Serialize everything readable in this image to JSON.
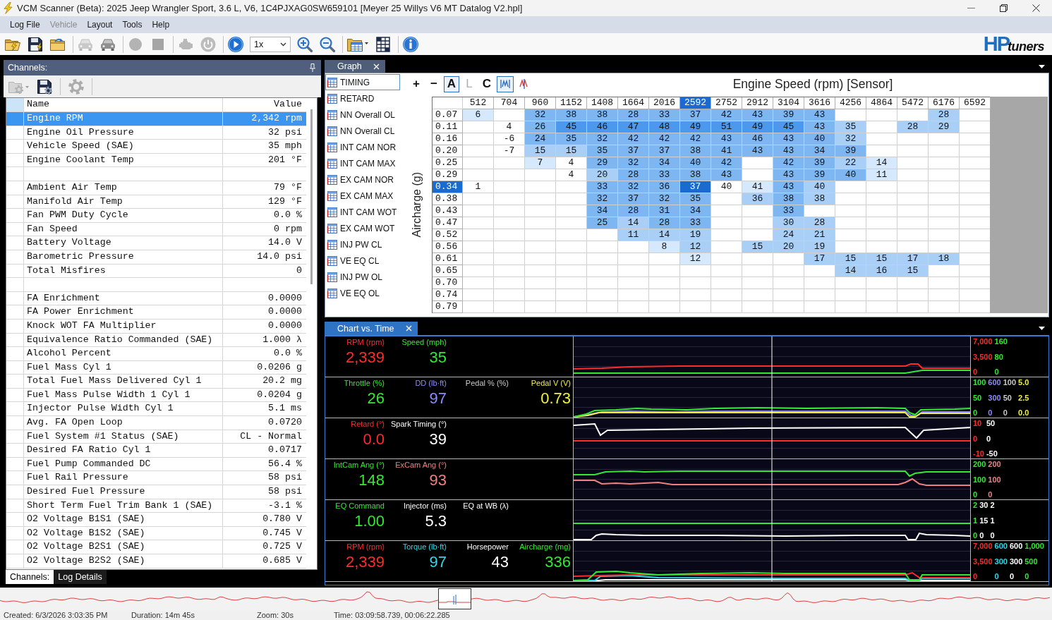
{
  "window": {
    "title": "VCM Scanner (Beta): 2025 Jeep Wrangler Sport, 3.6 L, V6, 1C4PJXAG0SW659101 [Meyer 25 Willys V6 MT Datalog V2.hpl]"
  },
  "menu": [
    {
      "label": "Log File",
      "disabled": false
    },
    {
      "label": "Vehicle",
      "disabled": true
    },
    {
      "label": "Layout",
      "disabled": false
    },
    {
      "label": "Tools",
      "disabled": false
    },
    {
      "label": "Help",
      "disabled": false
    }
  ],
  "toolbar": {
    "groups": [
      [
        {
          "kind": "open",
          "disabled": false
        },
        {
          "kind": "save",
          "disabled": false
        },
        {
          "kind": "reload",
          "disabled": false
        }
      ],
      [
        {
          "kind": "car",
          "disabled": true
        },
        {
          "kind": "car",
          "disabled": false
        }
      ],
      [
        {
          "kind": "record",
          "disabled": true
        },
        {
          "kind": "stop",
          "disabled": true
        }
      ],
      [
        {
          "kind": "engine",
          "disabled": true
        },
        {
          "kind": "power",
          "disabled": true
        }
      ],
      [
        {
          "kind": "play",
          "disabled": false
        },
        {
          "kind": "combo",
          "value": "1x",
          "disabled": false
        },
        {
          "kind": "zoom-in",
          "disabled": false
        },
        {
          "kind": "zoom-out",
          "disabled": false
        }
      ],
      [
        {
          "kind": "layout",
          "disabled": false
        },
        {
          "kind": "grid-save",
          "disabled": false
        }
      ],
      [
        {
          "kind": "info",
          "disabled": false
        }
      ]
    ],
    "logo": {
      "mark": "HP",
      "word": "tuners"
    }
  },
  "channels_panel": {
    "title": "Channels:",
    "tools": [
      {
        "kind": "folder-settings",
        "disabled": true
      },
      {
        "kind": "save-settings",
        "disabled": false
      },
      {
        "kind": "settings",
        "disabled": true
      }
    ],
    "columns": [
      "Name",
      "Value"
    ],
    "rows": [
      {
        "kind": "channel",
        "name": "Engine RPM",
        "value": "2,342 rpm",
        "selected": true
      },
      {
        "kind": "channel",
        "name": "Engine Oil Pressure",
        "value": "32 psi",
        "selected": false
      },
      {
        "kind": "channel",
        "name": "Vehicle Speed (SAE)",
        "value": "35 mph",
        "selected": false
      },
      {
        "kind": "channel",
        "name": "Engine Coolant Temp",
        "value": "201 °F",
        "selected": false
      },
      {
        "kind": "blank",
        "selected": false
      },
      {
        "kind": "channel",
        "name": "Ambient Air Temp",
        "value": "79 °F",
        "selected": false
      },
      {
        "kind": "channel",
        "name": "Manifold Air Temp",
        "value": "129 °F",
        "selected": false
      },
      {
        "kind": "channel",
        "name": "Fan PWM Duty Cycle",
        "value": "0.0 %",
        "selected": false
      },
      {
        "kind": "channel",
        "name": "Fan Speed",
        "value": "0 rpm",
        "selected": false
      },
      {
        "kind": "channel",
        "name": "Battery Voltage",
        "value": "14.0 V",
        "selected": false
      },
      {
        "kind": "channel",
        "name": "Barometric Pressure",
        "value": "14.0 psi",
        "selected": false
      },
      {
        "kind": "channel",
        "name": "Total Misfires",
        "value": "0",
        "selected": false
      },
      {
        "kind": "blank",
        "selected": false
      },
      {
        "kind": "channel",
        "name": "FA Enrichment",
        "value": "0.0000",
        "selected": false
      },
      {
        "kind": "channel",
        "name": "FA Power Enrichment",
        "value": "0.0000",
        "selected": false
      },
      {
        "kind": "channel",
        "name": "Knock WOT FA Multiplier",
        "value": "0.0000",
        "selected": false
      },
      {
        "kind": "channel",
        "name": "Equivalence Ratio Commanded (SAE)",
        "value": "1.000 λ",
        "selected": false
      },
      {
        "kind": "channel",
        "name": "Alcohol Percent",
        "value": "0.0 %",
        "selected": false
      },
      {
        "kind": "channel",
        "name": "Fuel Mass Cyl 1",
        "value": "0.0206 g",
        "selected": false
      },
      {
        "kind": "channel",
        "name": "Total Fuel Mass Delivered Cyl 1",
        "value": "20.2 mg",
        "selected": false
      },
      {
        "kind": "channel",
        "name": "Fuel Mass Pulse Width 1 Cyl 1",
        "value": "0.0204 g",
        "selected": false
      },
      {
        "kind": "channel",
        "name": "Injector Pulse Width Cyl 1",
        "value": "5.1 ms",
        "selected": false
      },
      {
        "kind": "channel",
        "name": "Avg. FA Open Loop",
        "value": "0.0720",
        "selected": false
      },
      {
        "kind": "channel",
        "name": "Fuel System #1 Status (SAE)",
        "value": "CL - Normal",
        "selected": false
      },
      {
        "kind": "channel",
        "name": "Desired FA Ratio Cyl 1",
        "value": "0.0717",
        "selected": false
      },
      {
        "kind": "channel",
        "name": "Fuel Pump Commanded DC",
        "value": "56.4 %",
        "selected": false
      },
      {
        "kind": "channel",
        "name": "Fuel Rail Pressure",
        "value": "58 psi",
        "selected": false
      },
      {
        "kind": "channel",
        "name": "Desired Fuel Pressure",
        "value": "58 psi",
        "selected": false
      },
      {
        "kind": "channel",
        "name": "Short Term Fuel Trim Bank 1 (SAE)",
        "value": "-3.1 %",
        "selected": false
      },
      {
        "kind": "channel",
        "name": "O2 Voltage B1S1 (SAE)",
        "value": "0.780 V",
        "selected": false
      },
      {
        "kind": "channel",
        "name": "O2 Voltage B1S2 (SAE)",
        "value": "0.745 V",
        "selected": false
      },
      {
        "kind": "channel",
        "name": "O2 Voltage B2S1 (SAE)",
        "value": "0.725 V",
        "selected": false
      },
      {
        "kind": "channel",
        "name": "O2 Voltage B2S2 (SAE)",
        "value": "0.685 V",
        "selected": false
      }
    ],
    "tabs": [
      {
        "label": "Channels:",
        "selected": true
      },
      {
        "label": "Log Details",
        "selected": false
      }
    ]
  },
  "graph_panel": {
    "tab": "Graph",
    "tables": [
      {
        "label": "TIMING",
        "selected": true
      },
      {
        "label": "RETARD",
        "selected": false
      },
      {
        "label": "NN Overall OL",
        "selected": false
      },
      {
        "label": "NN Overall CL",
        "selected": false
      },
      {
        "label": "INT CAM NOR",
        "selected": false
      },
      {
        "label": "INT CAM MAX",
        "selected": false
      },
      {
        "label": "EX CAM NOR",
        "selected": false
      },
      {
        "label": "EX CAM MAX",
        "selected": false
      },
      {
        "label": "INT CAM WOT",
        "selected": false
      },
      {
        "label": "EX CAM WOT",
        "selected": false
      },
      {
        "label": "INJ PW CL",
        "selected": false
      },
      {
        "label": "VE EQ CL",
        "selected": false
      },
      {
        "label": "INJ PW OL",
        "selected": false
      },
      {
        "label": "VE EQ OL",
        "selected": false
      }
    ],
    "tools": [
      {
        "kind": "text",
        "label": "+",
        "selected": false,
        "disabled": false
      },
      {
        "kind": "text",
        "label": "−",
        "selected": false,
        "disabled": false
      },
      {
        "kind": "text",
        "label": "A",
        "selected": true,
        "disabled": false
      },
      {
        "kind": "text",
        "label": "L",
        "selected": false,
        "disabled": true
      },
      {
        "kind": "text",
        "label": "C",
        "selected": false,
        "disabled": false
      },
      {
        "kind": "line-mode",
        "selected": true,
        "disabled": false
      },
      {
        "kind": "split-mode",
        "selected": false,
        "disabled": false
      }
    ],
    "title": "Engine Speed (rpm) [Sensor]",
    "y_label": "Aircharge (g)",
    "columns": [
      {
        "label": "512",
        "selected": false
      },
      {
        "label": "704",
        "selected": false
      },
      {
        "label": "960",
        "selected": false
      },
      {
        "label": "1152",
        "selected": false
      },
      {
        "label": "1408",
        "selected": false
      },
      {
        "label": "1664",
        "selected": false
      },
      {
        "label": "2016",
        "selected": false
      },
      {
        "label": "2592",
        "selected": true
      },
      {
        "label": "2752",
        "selected": false
      },
      {
        "label": "2912",
        "selected": false
      },
      {
        "label": "3104",
        "selected": false
      },
      {
        "label": "3616",
        "selected": false
      },
      {
        "label": "4256",
        "selected": false
      },
      {
        "label": "4864",
        "selected": false
      },
      {
        "label": "5472",
        "selected": false
      },
      {
        "label": "6176",
        "selected": false
      },
      {
        "label": "6592",
        "selected": false
      }
    ],
    "rows": [
      {
        "label": "0.07",
        "selected": false,
        "cells": [
          {
            "value": "6",
            "selected": false,
            "color": "#d6e8fb"
          },
          null,
          {
            "value": "32",
            "selected": false,
            "color": "#7db6f1"
          },
          {
            "value": "38",
            "selected": false,
            "color": "#7db6f1"
          },
          {
            "value": "38",
            "selected": false,
            "color": "#7db6f1"
          },
          {
            "value": "28",
            "selected": false,
            "color": "#7db6f1"
          },
          {
            "value": "33",
            "selected": false,
            "color": "#7db6f1"
          },
          {
            "value": "37",
            "selected": false,
            "color": "#7db6f1"
          },
          {
            "value": "42",
            "selected": false,
            "color": "#7db6f1"
          },
          {
            "value": "43",
            "selected": false,
            "color": "#7db6f1"
          },
          {
            "value": "39",
            "selected": false,
            "color": "#7db6f1"
          },
          {
            "value": "43",
            "selected": false,
            "color": "#7db6f1"
          },
          null,
          null,
          null,
          {
            "value": "28",
            "selected": false,
            "color": "#aacff6"
          },
          null
        ]
      },
      {
        "label": "0.11",
        "selected": false,
        "cells": [
          null,
          {
            "value": "4",
            "selected": false
          },
          {
            "value": "26",
            "selected": false,
            "color": "#7db6f1"
          },
          {
            "value": "45",
            "selected": false,
            "color": "#4b98ec"
          },
          {
            "value": "46",
            "selected": false,
            "color": "#4b98ec"
          },
          {
            "value": "47",
            "selected": false,
            "color": "#4b98ec"
          },
          {
            "value": "48",
            "selected": false,
            "color": "#4b98ec"
          },
          {
            "value": "49",
            "selected": false,
            "color": "#4b98ec"
          },
          {
            "value": "51",
            "selected": false,
            "color": "#4b98ec"
          },
          {
            "value": "49",
            "selected": false,
            "color": "#4b98ec"
          },
          {
            "value": "45",
            "selected": false,
            "color": "#4b98ec"
          },
          {
            "value": "43",
            "selected": false,
            "color": "#7db6f1"
          },
          {
            "value": "35",
            "selected": false,
            "color": "#aacff6"
          },
          null,
          {
            "value": "28",
            "selected": false,
            "color": "#aacff6"
          },
          {
            "value": "29",
            "selected": false,
            "color": "#aacff6"
          },
          null
        ]
      },
      {
        "label": "0.16",
        "selected": false,
        "cells": [
          null,
          {
            "value": "-6",
            "selected": false
          },
          {
            "value": "24",
            "selected": false,
            "color": "#7db6f1"
          },
          {
            "value": "35",
            "selected": false,
            "color": "#7db6f1"
          },
          {
            "value": "32",
            "selected": false,
            "color": "#7db6f1"
          },
          {
            "value": "42",
            "selected": false,
            "color": "#7db6f1"
          },
          {
            "value": "42",
            "selected": false,
            "color": "#7db6f1"
          },
          {
            "value": "42",
            "selected": false,
            "color": "#7db6f1"
          },
          {
            "value": "43",
            "selected": false,
            "color": "#7db6f1"
          },
          {
            "value": "46",
            "selected": false,
            "color": "#7db6f1"
          },
          {
            "value": "43",
            "selected": false,
            "color": "#7db6f1"
          },
          {
            "value": "40",
            "selected": false,
            "color": "#7db6f1"
          },
          {
            "value": "32",
            "selected": false,
            "color": "#aacff6"
          },
          null,
          null,
          null,
          null
        ]
      },
      {
        "label": "0.20",
        "selected": false,
        "cells": [
          null,
          {
            "value": "-7",
            "selected": false
          },
          {
            "value": "15",
            "selected": false,
            "color": "#aacff6"
          },
          {
            "value": "15",
            "selected": false,
            "color": "#aacff6"
          },
          {
            "value": "35",
            "selected": false,
            "color": "#7db6f1"
          },
          {
            "value": "37",
            "selected": false,
            "color": "#7db6f1"
          },
          {
            "value": "37",
            "selected": false,
            "color": "#7db6f1"
          },
          {
            "value": "38",
            "selected": false,
            "color": "#7db6f1"
          },
          {
            "value": "41",
            "selected": false,
            "color": "#7db6f1"
          },
          {
            "value": "43",
            "selected": false,
            "color": "#7db6f1"
          },
          {
            "value": "43",
            "selected": false,
            "color": "#7db6f1"
          },
          {
            "value": "34",
            "selected": false,
            "color": "#7db6f1"
          },
          {
            "value": "39",
            "selected": false,
            "color": "#7db6f1"
          },
          null,
          null,
          null,
          null
        ]
      },
      {
        "label": "0.25",
        "selected": false,
        "cells": [
          null,
          null,
          {
            "value": "7",
            "selected": false,
            "color": "#d6e8fb"
          },
          {
            "value": "4",
            "selected": false
          },
          {
            "value": "29",
            "selected": false,
            "color": "#7db6f1"
          },
          {
            "value": "32",
            "selected": false,
            "color": "#7db6f1"
          },
          {
            "value": "34",
            "selected": false,
            "color": "#7db6f1"
          },
          {
            "value": "40",
            "selected": false,
            "color": "#7db6f1"
          },
          {
            "value": "42",
            "selected": false,
            "color": "#7db6f1"
          },
          null,
          {
            "value": "42",
            "selected": false,
            "color": "#7db6f1"
          },
          {
            "value": "39",
            "selected": false,
            "color": "#7db6f1"
          },
          {
            "value": "22",
            "selected": false,
            "color": "#aacff6"
          },
          {
            "value": "14",
            "selected": false,
            "color": "#d6e8fb"
          },
          null,
          null,
          null
        ]
      },
      {
        "label": "0.29",
        "selected": false,
        "cells": [
          null,
          null,
          null,
          {
            "value": "4",
            "selected": false
          },
          {
            "value": "20",
            "selected": false,
            "color": "#aacff6"
          },
          {
            "value": "28",
            "selected": false,
            "color": "#7db6f1"
          },
          {
            "value": "33",
            "selected": false,
            "color": "#7db6f1"
          },
          {
            "value": "38",
            "selected": false,
            "color": "#7db6f1"
          },
          {
            "value": "43",
            "selected": false,
            "color": "#7db6f1"
          },
          null,
          {
            "value": "43",
            "selected": false,
            "color": "#7db6f1"
          },
          {
            "value": "39",
            "selected": false,
            "color": "#7db6f1"
          },
          {
            "value": "40",
            "selected": false,
            "color": "#7db6f1"
          },
          {
            "value": "11",
            "selected": false,
            "color": "#d6e8fb"
          },
          null,
          null,
          null
        ]
      },
      {
        "label": "0.34",
        "selected": true,
        "cells": [
          {
            "value": "1",
            "selected": false
          },
          null,
          null,
          null,
          {
            "value": "33",
            "selected": false,
            "color": "#7db6f1"
          },
          {
            "value": "32",
            "selected": false,
            "color": "#7db6f1"
          },
          {
            "value": "36",
            "selected": false,
            "color": "#7db6f1"
          },
          {
            "value": "37",
            "selected": true
          },
          {
            "value": "40",
            "selected": false
          },
          {
            "value": "41",
            "selected": false,
            "color": "#d6e8fb"
          },
          {
            "value": "43",
            "selected": false,
            "color": "#7db6f1"
          },
          {
            "value": "40",
            "selected": false,
            "color": "#aacff6"
          },
          null,
          null,
          null,
          null,
          null
        ]
      },
      {
        "label": "0.38",
        "selected": false,
        "cells": [
          null,
          null,
          null,
          null,
          {
            "value": "32",
            "selected": false,
            "color": "#7db6f1"
          },
          {
            "value": "37",
            "selected": false,
            "color": "#7db6f1"
          },
          {
            "value": "32",
            "selected": false,
            "color": "#7db6f1"
          },
          {
            "value": "35",
            "selected": false,
            "color": "#7db6f1"
          },
          null,
          {
            "value": "36",
            "selected": false,
            "color": "#aacff6"
          },
          {
            "value": "38",
            "selected": false,
            "color": "#7db6f1"
          },
          {
            "value": "38",
            "selected": false,
            "color": "#aacff6"
          },
          null,
          null,
          null,
          null,
          null
        ]
      },
      {
        "label": "0.43",
        "selected": false,
        "cells": [
          null,
          null,
          null,
          null,
          {
            "value": "34",
            "selected": false,
            "color": "#7db6f1"
          },
          {
            "value": "28",
            "selected": false,
            "color": "#7db6f1"
          },
          {
            "value": "31",
            "selected": false,
            "color": "#7db6f1"
          },
          {
            "value": "34",
            "selected": false,
            "color": "#7db6f1"
          },
          null,
          null,
          {
            "value": "33",
            "selected": false,
            "color": "#7db6f1"
          },
          null,
          null,
          null,
          null,
          null,
          null
        ]
      },
      {
        "label": "0.47",
        "selected": false,
        "cells": [
          null,
          null,
          null,
          null,
          {
            "value": "25",
            "selected": false,
            "color": "#7db6f1"
          },
          {
            "value": "14",
            "selected": false,
            "color": "#aacff6"
          },
          {
            "value": "28",
            "selected": false,
            "color": "#7db6f1"
          },
          {
            "value": "33",
            "selected": false,
            "color": "#7db6f1"
          },
          null,
          null,
          {
            "value": "30",
            "selected": false,
            "color": "#aacff6"
          },
          {
            "value": "28",
            "selected": false,
            "color": "#aacff6"
          },
          null,
          null,
          null,
          null,
          null
        ]
      },
      {
        "label": "0.52",
        "selected": false,
        "cells": [
          null,
          null,
          null,
          null,
          null,
          {
            "value": "11",
            "selected": false,
            "color": "#aacff6"
          },
          {
            "value": "14",
            "selected": false,
            "color": "#aacff6"
          },
          {
            "value": "19",
            "selected": false,
            "color": "#aacff6"
          },
          null,
          null,
          {
            "value": "24",
            "selected": false,
            "color": "#aacff6"
          },
          {
            "value": "21",
            "selected": false,
            "color": "#aacff6"
          },
          null,
          null,
          null,
          null,
          null
        ]
      },
      {
        "label": "0.56",
        "selected": false,
        "cells": [
          null,
          null,
          null,
          null,
          null,
          null,
          {
            "value": "8",
            "selected": false,
            "color": "#d6e8fb"
          },
          {
            "value": "12",
            "selected": false,
            "color": "#aacff6"
          },
          null,
          {
            "value": "15",
            "selected": false,
            "color": "#aacff6"
          },
          {
            "value": "20",
            "selected": false,
            "color": "#aacff6"
          },
          {
            "value": "19",
            "selected": false,
            "color": "#aacff6"
          },
          null,
          null,
          null,
          null,
          null
        ]
      },
      {
        "label": "0.61",
        "selected": false,
        "cells": [
          null,
          null,
          null,
          null,
          null,
          null,
          null,
          {
            "value": "12",
            "selected": false,
            "color": "#d6e8fb"
          },
          null,
          null,
          null,
          {
            "value": "17",
            "selected": false,
            "color": "#aacff6"
          },
          {
            "value": "15",
            "selected": false,
            "color": "#aacff6"
          },
          {
            "value": "15",
            "selected": false,
            "color": "#aacff6"
          },
          {
            "value": "17",
            "selected": false,
            "color": "#aacff6"
          },
          {
            "value": "18",
            "selected": false,
            "color": "#aacff6"
          },
          null
        ]
      },
      {
        "label": "0.65",
        "selected": false,
        "cells": [
          null,
          null,
          null,
          null,
          null,
          null,
          null,
          null,
          null,
          null,
          null,
          null,
          {
            "value": "14",
            "selected": false,
            "color": "#aacff6"
          },
          {
            "value": "16",
            "selected": false,
            "color": "#aacff6"
          },
          {
            "value": "15",
            "selected": false,
            "color": "#aacff6"
          },
          null,
          null
        ]
      },
      {
        "label": "0.70",
        "selected": false
      },
      {
        "label": "0.74",
        "selected": false
      },
      {
        "label": "0.79",
        "selected": false
      }
    ]
  },
  "chart_panel": {
    "tab": "Chart vs. Time",
    "strips": [
      {
        "gauges": [
          {
            "label": "RPM (rpm)",
            "value": "2,339",
            "color": "#ff2a2a"
          },
          {
            "label": "Speed (mph)",
            "value": "35",
            "color": "#33e833"
          }
        ],
        "axes": [
          {
            "color": "#ff2a2a",
            "labels": [
              "7,000",
              "3,500",
              "0"
            ]
          },
          {
            "color": "#33e833",
            "labels": [
              "160",
              "80",
              "0"
            ]
          }
        ]
      },
      {
        "gauges": [
          {
            "label": "Throttle (%)",
            "value": "26",
            "color": "#33e833"
          },
          {
            "label": "DD (lb·ft)",
            "value": "97",
            "color": "#8c8cff"
          },
          {
            "label": "Pedal % (%)",
            "color": "#c8c8c8"
          },
          {
            "label": "Pedal V (V)",
            "value": "0.73",
            "color": "#f0f040"
          }
        ],
        "axes": [
          {
            "color": "#33e833",
            "labels": [
              "100",
              "50",
              "0"
            ]
          },
          {
            "color": "#8c8cff",
            "labels": [
              "600",
              "300",
              "0"
            ]
          },
          {
            "color": "#c8c8c8",
            "labels": [
              "100",
              "50",
              "0"
            ]
          },
          {
            "color": "#f0f040",
            "labels": [
              "5.0",
              "2.5",
              "0.0"
            ]
          }
        ]
      },
      {
        "gauges": [
          {
            "label": "Retard (°)",
            "value": "0.0",
            "color": "#ff2a2a"
          },
          {
            "label": "Spark Timing (°)",
            "value": "39",
            "color": "#ffffff"
          }
        ],
        "axes": [
          {
            "color": "#ff2a2a",
            "labels": [
              "10",
              "0",
              "-10"
            ]
          },
          {
            "color": "#ffffff",
            "labels": [
              "50",
              "0",
              "-50"
            ]
          }
        ]
      },
      {
        "gauges": [
          {
            "label": "IntCam Ang (°)",
            "value": "148",
            "color": "#33e833"
          },
          {
            "label": "ExCam Ang (°)",
            "value": "93",
            "color": "#f08080"
          }
        ],
        "axes": [
          {
            "color": "#33e833",
            "labels": [
              "200",
              "100",
              "0"
            ]
          },
          {
            "color": "#f08080",
            "labels": [
              "200",
              "100",
              "0"
            ]
          }
        ]
      },
      {
        "gauges": [
          {
            "label": "EQ Command",
            "value": "1.00",
            "color": "#33e833"
          },
          {
            "label": "Injector (ms)",
            "value": "5.3",
            "color": "#ffffff"
          },
          {
            "label": "EQ at WB (λ)",
            "color": "#ffffff"
          }
        ],
        "axes": [
          {
            "color": "#33e833",
            "labels": [
              "2",
              "1",
              "0"
            ]
          },
          {
            "color": "#ffffff",
            "labels": [
              "30",
              "15",
              "0"
            ]
          },
          {
            "color": "#ffffff",
            "labels": [
              "2",
              "1",
              "0"
            ]
          }
        ]
      },
      {
        "gauges": [
          {
            "label": "RPM (rpm)",
            "value": "2,339",
            "color": "#ff2a2a"
          },
          {
            "label": "Torque (lb·ft)",
            "value": "97",
            "color": "#30d8e8"
          },
          {
            "label": "Horsepower",
            "value": "43",
            "color": "#ffffff"
          },
          {
            "label": "Aircharge (mg)",
            "value": "336",
            "color": "#33e833"
          }
        ],
        "axes": [
          {
            "color": "#ff2a2a",
            "labels": [
              "7,000",
              "3,500",
              "0"
            ]
          },
          {
            "color": "#30d8e8",
            "labels": [
              "600",
              "300",
              "0"
            ]
          },
          {
            "color": "#ffffff",
            "labels": [
              "600",
              "300",
              "0"
            ]
          },
          {
            "color": "#33e833",
            "labels": [
              "1,000",
              "500",
              "0"
            ]
          }
        ]
      }
    ]
  },
  "status_bar": {
    "items": [
      "Created: 6/3/2026 3:03:35 PM",
      "Duration: 14m 45s",
      "Zoom: 30s",
      "Time: 03:09:58.739, 00:06:22.285"
    ]
  }
}
